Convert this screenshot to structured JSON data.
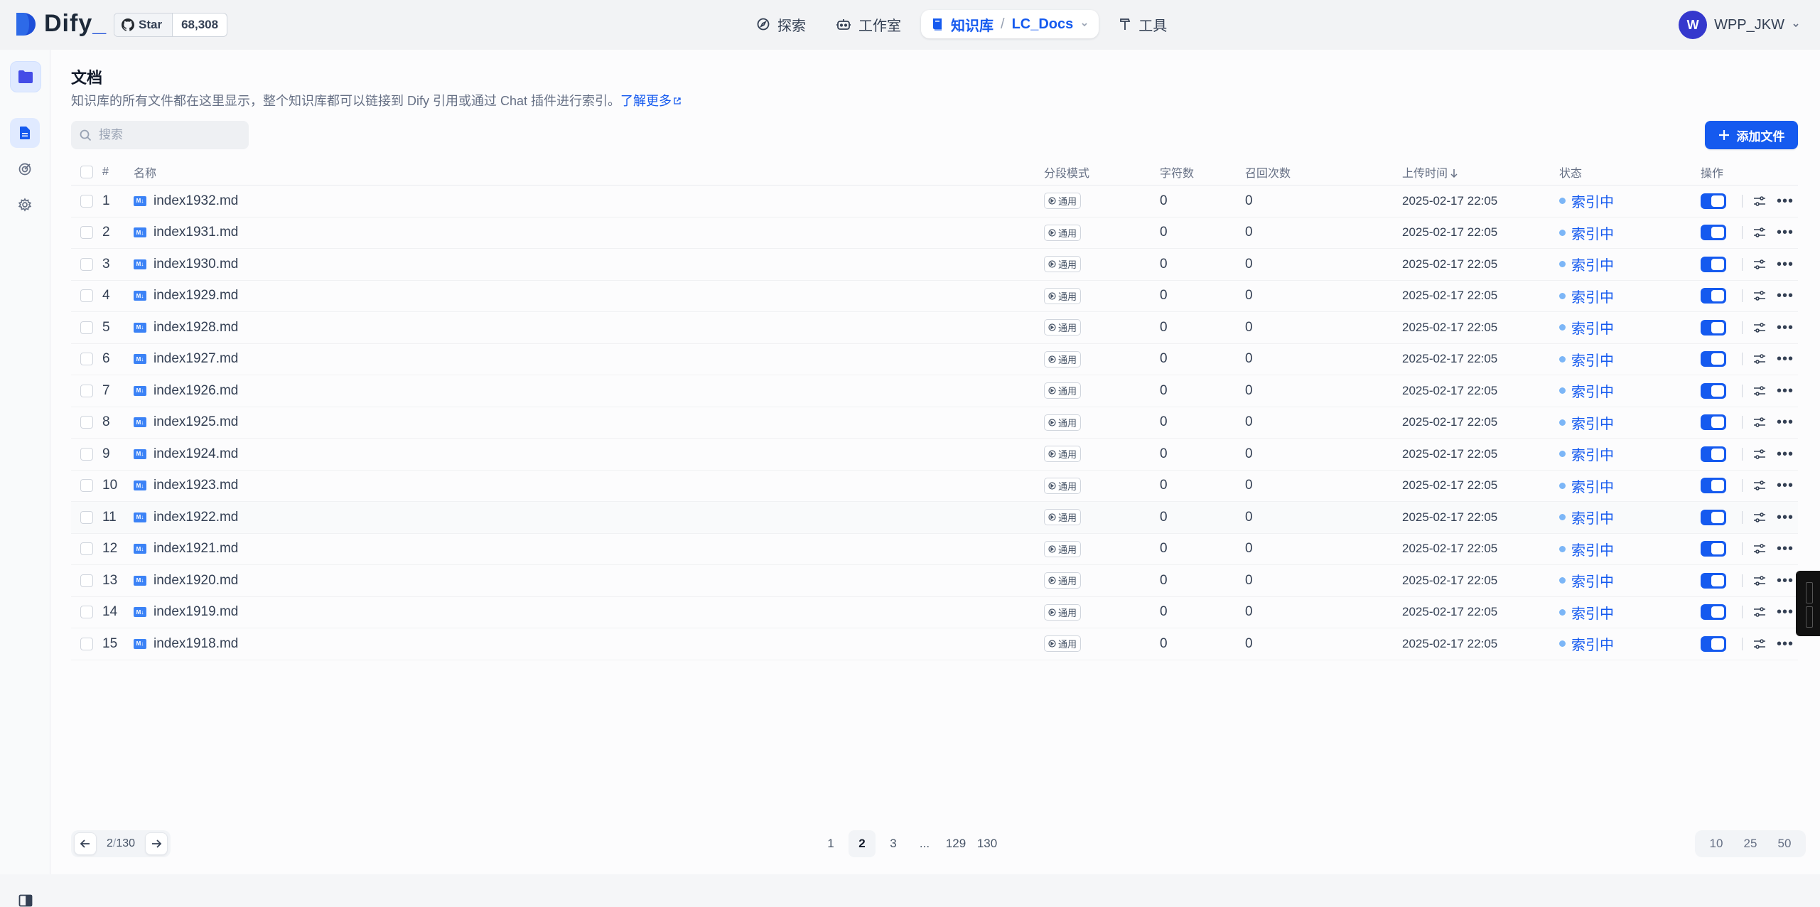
{
  "app": {
    "logo_text": "Dify",
    "github": {
      "star_label": "Star",
      "count": "68,308"
    }
  },
  "nav": {
    "explore": "探索",
    "studio": "工作室",
    "knowledge": "知识库",
    "separator": "/",
    "dataset": "LC_Docs",
    "tools": "工具"
  },
  "user": {
    "initial": "W",
    "name": "WPP_JKW"
  },
  "page": {
    "title": "文档",
    "description": "知识库的所有文件都在这里显示，整个知识库都可以链接到 Dify 引用或通过 Chat 插件进行索引。",
    "learn_more": "了解更多",
    "search_placeholder": "搜索",
    "add_button": "添加文件"
  },
  "table": {
    "headers": {
      "index": "#",
      "name": "名称",
      "mode": "分段模式",
      "chars": "字符数",
      "hits": "召回次数",
      "upload_time": "上传时间",
      "status": "状态",
      "actions": "操作"
    },
    "mode_label": "通用",
    "status_label": "索引中",
    "rows": [
      {
        "idx": "1",
        "name": "index1932.md",
        "chars": "0",
        "hits": "0",
        "time": "2025-02-17 22:05"
      },
      {
        "idx": "2",
        "name": "index1931.md",
        "chars": "0",
        "hits": "0",
        "time": "2025-02-17 22:05"
      },
      {
        "idx": "3",
        "name": "index1930.md",
        "chars": "0",
        "hits": "0",
        "time": "2025-02-17 22:05"
      },
      {
        "idx": "4",
        "name": "index1929.md",
        "chars": "0",
        "hits": "0",
        "time": "2025-02-17 22:05"
      },
      {
        "idx": "5",
        "name": "index1928.md",
        "chars": "0",
        "hits": "0",
        "time": "2025-02-17 22:05"
      },
      {
        "idx": "6",
        "name": "index1927.md",
        "chars": "0",
        "hits": "0",
        "time": "2025-02-17 22:05"
      },
      {
        "idx": "7",
        "name": "index1926.md",
        "chars": "0",
        "hits": "0",
        "time": "2025-02-17 22:05"
      },
      {
        "idx": "8",
        "name": "index1925.md",
        "chars": "0",
        "hits": "0",
        "time": "2025-02-17 22:05"
      },
      {
        "idx": "9",
        "name": "index1924.md",
        "chars": "0",
        "hits": "0",
        "time": "2025-02-17 22:05"
      },
      {
        "idx": "10",
        "name": "index1923.md",
        "chars": "0",
        "hits": "0",
        "time": "2025-02-17 22:05"
      },
      {
        "idx": "11",
        "name": "index1922.md",
        "chars": "0",
        "hits": "0",
        "time": "2025-02-17 22:05"
      },
      {
        "idx": "12",
        "name": "index1921.md",
        "chars": "0",
        "hits": "0",
        "time": "2025-02-17 22:05"
      },
      {
        "idx": "13",
        "name": "index1920.md",
        "chars": "0",
        "hits": "0",
        "time": "2025-02-17 22:05"
      },
      {
        "idx": "14",
        "name": "index1919.md",
        "chars": "0",
        "hits": "0",
        "time": "2025-02-17 22:05"
      },
      {
        "idx": "15",
        "name": "index1918.md",
        "chars": "0",
        "hits": "0",
        "time": "2025-02-17 22:05"
      }
    ]
  },
  "pagination": {
    "current": "2",
    "slash": "/",
    "total": "130",
    "pages": [
      "1",
      "2",
      "3",
      "...",
      "129",
      "130"
    ],
    "page_sizes": [
      "10",
      "25",
      "50"
    ]
  },
  "colors": {
    "accent": "#155aef",
    "status_dot": "#7cb6f7",
    "avatar": "#3538cd"
  }
}
